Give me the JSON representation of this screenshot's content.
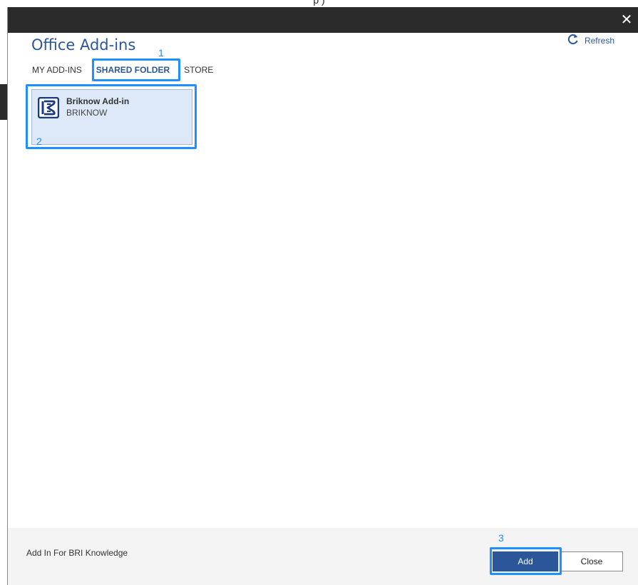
{
  "background": {
    "caption_fragment": "p  )"
  },
  "dialog": {
    "title": "Office Add-ins",
    "refresh_label": "Refresh",
    "close_glyph": "✕",
    "tabs": [
      {
        "label": "MY ADD-INS",
        "active": false
      },
      {
        "label": "SHARED FOLDER",
        "active": true
      },
      {
        "label": "STORE",
        "active": false
      }
    ],
    "addin": {
      "name": "Briknow Add-in",
      "publisher": "BRIKNOW",
      "logo_icon": "briknow-logo"
    },
    "footer": {
      "description": "Add In For BRI Knowledge",
      "add_label": "Add",
      "close_label": "Close"
    }
  },
  "annotations": {
    "marker_1": "1",
    "marker_2": "2",
    "marker_3": "3",
    "color": "#1e90ff"
  },
  "colors": {
    "accent": "#2b579a",
    "titlebar": "#2b2b2b",
    "tile_selected": "#dde8f8"
  }
}
